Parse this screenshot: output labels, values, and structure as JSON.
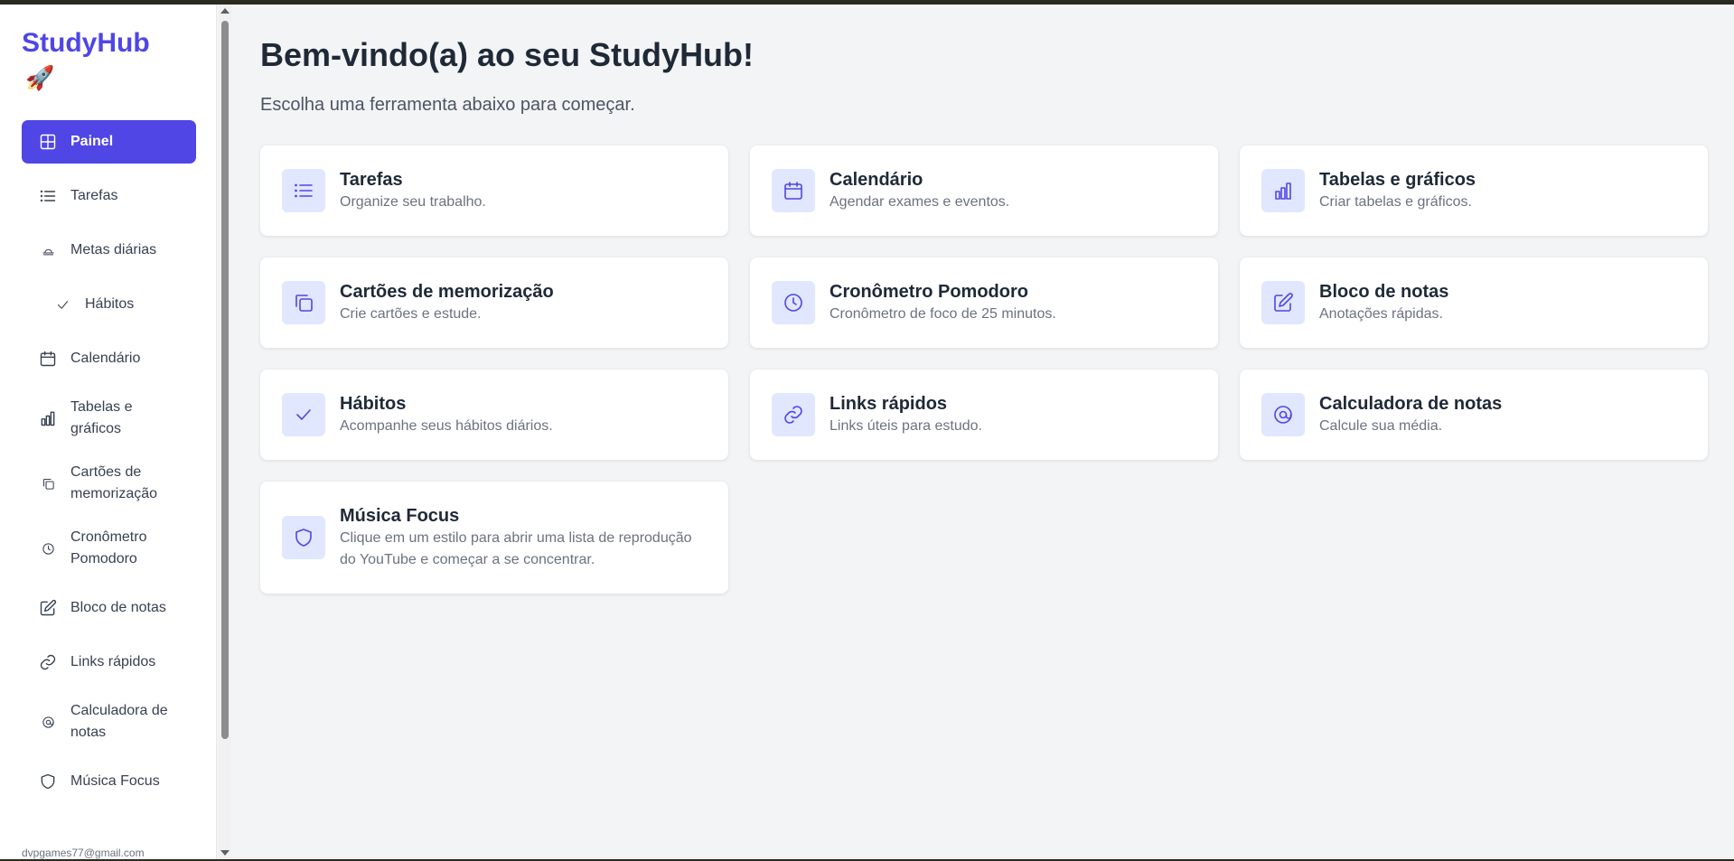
{
  "brand": {
    "name": "StudyHub",
    "emoji": "🚀"
  },
  "sidebar": {
    "items": [
      {
        "label": "Painel",
        "icon": "grid-icon"
      },
      {
        "label": "Tarefas",
        "icon": "list-icon"
      },
      {
        "label": "Metas diárias",
        "icon": "hat-icon"
      },
      {
        "label": "Hábitos",
        "icon": "check-icon"
      },
      {
        "label": "Calendário",
        "icon": "calendar-icon"
      },
      {
        "label": "Tabelas e gráficos",
        "icon": "bar-chart-icon"
      },
      {
        "label": "Cartões de memorização",
        "icon": "cards-icon"
      },
      {
        "label": "Cronômetro Pomodoro",
        "icon": "clock-icon"
      },
      {
        "label": "Bloco de notas",
        "icon": "edit-icon"
      },
      {
        "label": "Links rápidos",
        "icon": "link-icon"
      },
      {
        "label": "Calculadora de notas",
        "icon": "at-icon"
      },
      {
        "label": "Música Focus",
        "icon": "shield-icon"
      }
    ],
    "user_email": "dvpgames77@gmail.com"
  },
  "main": {
    "title": "Bem-vindo(a) ao seu StudyHub!",
    "subtitle": "Escolha uma ferramenta abaixo para começar.",
    "cards": [
      {
        "title": "Tarefas",
        "desc": "Organize seu trabalho.",
        "icon": "list-icon"
      },
      {
        "title": "Calendário",
        "desc": "Agendar exames e eventos.",
        "icon": "calendar-icon"
      },
      {
        "title": "Tabelas e gráficos",
        "desc": "Criar tabelas e gráficos.",
        "icon": "bar-chart-icon"
      },
      {
        "title": "Cartões de memorização",
        "desc": "Crie cartões e estude.",
        "icon": "cards-icon"
      },
      {
        "title": "Cronômetro Pomodoro",
        "desc": "Cronômetro de foco de 25 minutos.",
        "icon": "clock-icon"
      },
      {
        "title": "Bloco de notas",
        "desc": "Anotações rápidas.",
        "icon": "edit-icon"
      },
      {
        "title": "Hábitos",
        "desc": "Acompanhe seus hábitos diários.",
        "icon": "check-icon"
      },
      {
        "title": "Links rápidos",
        "desc": "Links úteis para estudo.",
        "icon": "link-icon"
      },
      {
        "title": "Calculadora de notas",
        "desc": "Calcule sua média.",
        "icon": "at-icon"
      },
      {
        "title": "Música Focus",
        "desc": "Clique em um estilo para abrir uma lista de reprodução do YouTube e começar a se concentrar.",
        "icon": "shield-icon"
      }
    ]
  },
  "colors": {
    "accent": "#4f46e5",
    "icon_bg": "#e0e7ff",
    "page_bg": "#f3f4f6"
  }
}
